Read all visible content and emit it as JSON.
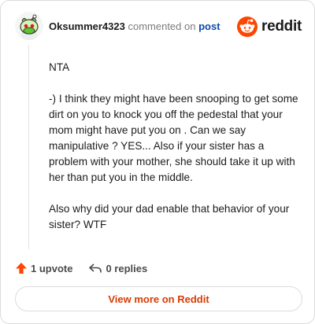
{
  "comment": {
    "username": "Oksummer4323",
    "verb": "commented on",
    "post_link": "post",
    "paragraphs": [
      "NTA",
      "-) I think they might have been snooping to get some dirt on you to knock you off the pedestal that your mom might have put you on . Can we say manipulative ? YES... Also if your sister has a problem with your mother, she should take it up with her than put you in the middle.",
      "Also why did your dad enable that behavior of your sister? WTF"
    ]
  },
  "brand": {
    "wordmark": "reddit",
    "color": "#ff4500"
  },
  "actions": {
    "upvotes": "1 upvote",
    "replies": "0 replies"
  },
  "footer": {
    "view_more": "View more on Reddit"
  },
  "colors": {
    "accent": "#ff4500",
    "link": "#0a4cad",
    "cta": "#d93a00"
  }
}
